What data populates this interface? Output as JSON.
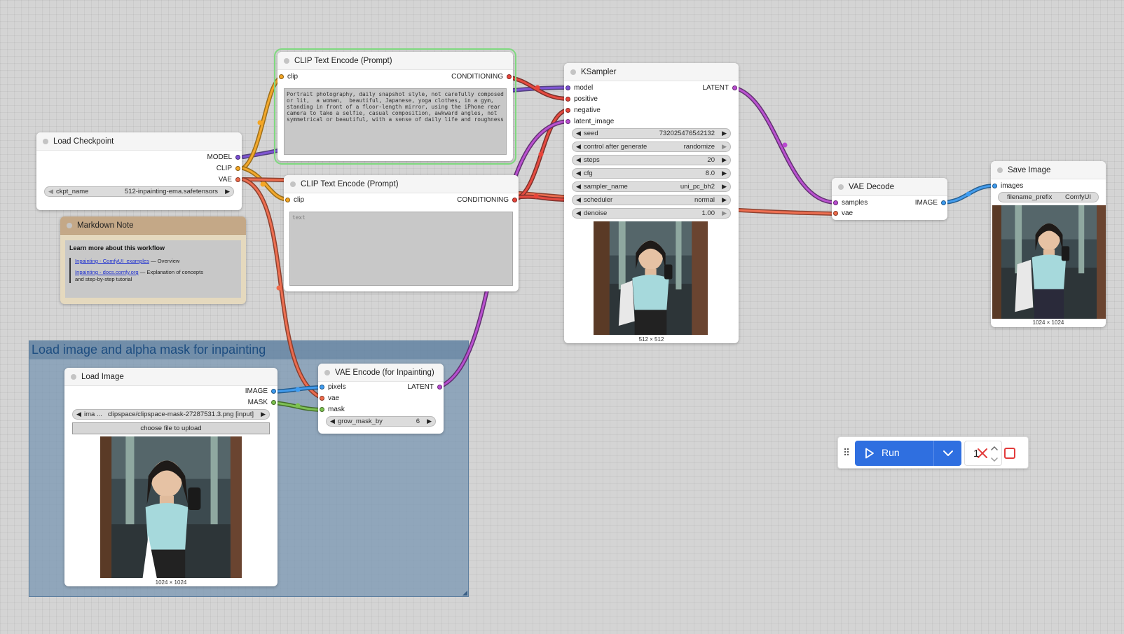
{
  "colors": {
    "model": "#7b4fd4",
    "clip": "#f5a623",
    "vae": "#f06a4a",
    "conditioning": "#e8443a",
    "latent": "#b94bd0",
    "image": "#3d9bf0",
    "mask": "#7cc24f",
    "run_button": "#2f6fe0",
    "selected_outline": "#7fd97f"
  },
  "group": {
    "title": "Load image and alpha mask for inpainting"
  },
  "load_checkpoint": {
    "title": "Load Checkpoint",
    "outputs": [
      "MODEL",
      "CLIP",
      "VAE"
    ],
    "ckpt_label": "ckpt_name",
    "ckpt_value": "512-inpainting-ema.safetensors"
  },
  "markdown_note": {
    "title": "Markdown Note",
    "heading": "Learn more about this workflow",
    "link1_text": "Inpainting - ComfyUI_examples",
    "link1_desc": " — Overview",
    "link2_text": "Inpainting - docs.comfy.org",
    "link2_desc": " — Explanation of concepts",
    "link2_desc2": "and step-by-step tutorial"
  },
  "clip_positive": {
    "title": "CLIP Text Encode (Prompt)",
    "input": "clip",
    "output": "CONDITIONING",
    "text": "Portrait photography, daily snapshot style, not carefully composed or lit,  a woman,  beautiful, Japanese, yoga clothes, in a gym, standing in front of a floor-length mirror, using the iPhone rear camera to take a selfie, casual composition, awkward angles, not symmetrical or beautiful, with a sense of daily life and roughness"
  },
  "clip_negative": {
    "title": "CLIP Text Encode (Prompt)",
    "input": "clip",
    "output": "CONDITIONING",
    "placeholder": "text"
  },
  "ksampler": {
    "title": "KSampler",
    "inputs": [
      "model",
      "positive",
      "negative",
      "latent_image"
    ],
    "output": "LATENT",
    "widgets": [
      {
        "label": "seed",
        "value": "732025476542132"
      },
      {
        "label": "control after generate",
        "value": "randomize"
      },
      {
        "label": "steps",
        "value": "20"
      },
      {
        "label": "cfg",
        "value": "8.0"
      },
      {
        "label": "sampler_name",
        "value": "uni_pc_bh2"
      },
      {
        "label": "scheduler",
        "value": "normal"
      },
      {
        "label": "denoise",
        "value": "1.00"
      }
    ],
    "preview_caption": "512 × 512"
  },
  "vae_decode": {
    "title": "VAE Decode",
    "inputs": [
      "samples",
      "vae"
    ],
    "output": "IMAGE"
  },
  "save_image": {
    "title": "Save Image",
    "input": "images",
    "prefix_label": "filename_prefix",
    "prefix_value": "ComfyUI",
    "preview_caption": "1024 × 1024"
  },
  "load_image": {
    "title": "Load Image",
    "outputs": [
      "IMAGE",
      "MASK"
    ],
    "image_label": "ima ...",
    "image_value": "clipspace/clipspace-mask-27287531.3.png [input]",
    "upload_label": "choose file to upload",
    "preview_caption": "1024 × 1024"
  },
  "vae_encode": {
    "title": "VAE Encode (for Inpainting)",
    "inputs": [
      "pixels",
      "vae",
      "mask"
    ],
    "output": "LATENT",
    "grow_label": "grow_mask_by",
    "grow_value": "6"
  },
  "toolbar": {
    "run_label": "Run",
    "batch_count": "1"
  }
}
